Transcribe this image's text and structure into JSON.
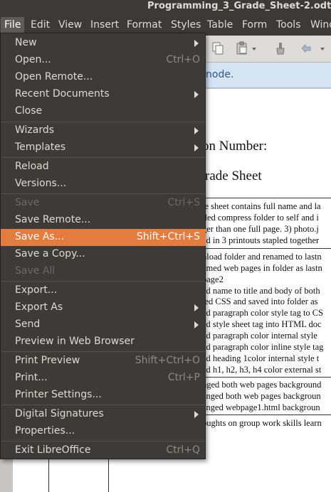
{
  "window": {
    "title": "Programming_3_Grade_Sheet-2.odt ("
  },
  "menubar": {
    "items": [
      "File",
      "Edit",
      "View",
      "Insert",
      "Format",
      "Styles",
      "Table",
      "Form",
      "Tools",
      "Wind"
    ]
  },
  "infobar": {
    "text": "node."
  },
  "document": {
    "heading1": "on Number:",
    "heading2": "rade Sheet",
    "lines": [
      "le sheet contains full name and la",
      "iled compress folder to self and i",
      "ger than one full page. 3) photo.j",
      "ed in 3 printouts stapled together",
      "nload folder and renamed to lastn",
      "amed web pages in folder as lastn",
      "page2",
      "ed name to title and body of both",
      "ted CSS and saved into folder as",
      "ed paragraph color style tag to CS",
      "ed style sheet tag into HTML doc",
      "ed paragraph color internal style",
      "ed paragraph color inline style tag",
      "ed heading 1color internal style t",
      "ed h1, h2, h3, h4 color external st",
      "nged both web pages background",
      "anged both web pages backgroun",
      "anged webpage1.html backgroun",
      "oughts on group work skills learn"
    ]
  },
  "file_menu": {
    "items": [
      {
        "label": "New",
        "shortcut": "",
        "submenu": true,
        "enabled": true
      },
      {
        "label": "Open...",
        "shortcut": "Ctrl+O",
        "submenu": false,
        "enabled": true
      },
      {
        "label": "Open Remote...",
        "shortcut": "",
        "submenu": false,
        "enabled": true
      },
      {
        "label": "Recent Documents",
        "shortcut": "",
        "submenu": true,
        "enabled": true
      },
      {
        "label": "Close",
        "shortcut": "",
        "submenu": false,
        "enabled": true
      },
      {
        "label": "Wizards",
        "shortcut": "",
        "submenu": true,
        "enabled": true
      },
      {
        "label": "Templates",
        "shortcut": "",
        "submenu": true,
        "enabled": true
      },
      {
        "label": "Reload",
        "shortcut": "",
        "submenu": false,
        "enabled": true
      },
      {
        "label": "Versions...",
        "shortcut": "",
        "submenu": false,
        "enabled": true
      },
      {
        "label": "Save",
        "shortcut": "Ctrl+S",
        "submenu": false,
        "enabled": false
      },
      {
        "label": "Save Remote...",
        "shortcut": "",
        "submenu": false,
        "enabled": true
      },
      {
        "label": "Save As...",
        "shortcut": "Shift+Ctrl+S",
        "submenu": false,
        "enabled": true,
        "highlighted": true
      },
      {
        "label": "Save a Copy...",
        "shortcut": "",
        "submenu": false,
        "enabled": true
      },
      {
        "label": "Save All",
        "shortcut": "",
        "submenu": false,
        "enabled": false
      },
      {
        "label": "Export...",
        "shortcut": "",
        "submenu": false,
        "enabled": true
      },
      {
        "label": "Export As",
        "shortcut": "",
        "submenu": true,
        "enabled": true
      },
      {
        "label": "Send",
        "shortcut": "",
        "submenu": true,
        "enabled": true
      },
      {
        "label": "Preview in Web Browser",
        "shortcut": "",
        "submenu": false,
        "enabled": true
      },
      {
        "label": "Print Preview",
        "shortcut": "Shift+Ctrl+O",
        "submenu": false,
        "enabled": true
      },
      {
        "label": "Print...",
        "shortcut": "Ctrl+P",
        "submenu": false,
        "enabled": true
      },
      {
        "label": "Printer Settings...",
        "shortcut": "",
        "submenu": false,
        "enabled": true
      },
      {
        "label": "Digital Signatures",
        "shortcut": "",
        "submenu": true,
        "enabled": true
      },
      {
        "label": "Properties...",
        "shortcut": "",
        "submenu": false,
        "enabled": true
      },
      {
        "label": "Exit LibreOffice",
        "shortcut": "Ctrl+Q",
        "submenu": false,
        "enabled": true
      }
    ]
  },
  "colors": {
    "menu_bg": "#3c3b37",
    "highlight": "#e57c3f",
    "text": "#dfdbd2",
    "disabled_text": "#6c6a65"
  }
}
